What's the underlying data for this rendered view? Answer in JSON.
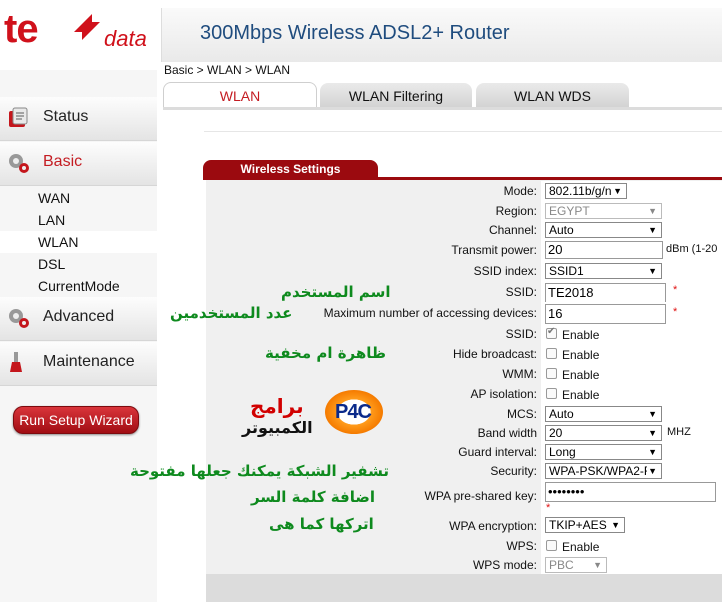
{
  "logo": {
    "brand": "te",
    "suffix": "data"
  },
  "header": {
    "title": "300Mbps Wireless ADSL2+ Router"
  },
  "breadcrumb": "Basic > WLAN > WLAN",
  "tabs": [
    {
      "label": "WLAN",
      "active": true
    },
    {
      "label": "WLAN Filtering",
      "active": false
    },
    {
      "label": "WLAN WDS",
      "active": false
    }
  ],
  "sidebar": {
    "groups": [
      {
        "label": "Status",
        "icon": "status-icon"
      },
      {
        "label": "Basic",
        "icon": "gears-icon",
        "active": true
      },
      {
        "label": "Advanced",
        "icon": "gears-icon"
      },
      {
        "label": "Maintenance",
        "icon": "wrench-icon"
      }
    ],
    "basic_items": [
      "WAN",
      "LAN",
      "WLAN",
      "DSL",
      "CurrentMode"
    ],
    "selected_item": "WLAN",
    "wizard_button": "Run Setup Wizard"
  },
  "section": {
    "title": "Wireless Settings"
  },
  "form": {
    "mode": {
      "label": "Mode:",
      "value": "802.11b/g/n"
    },
    "region": {
      "label": "Region:",
      "value": "EGYPT"
    },
    "channel": {
      "label": "Channel:",
      "value": "Auto"
    },
    "transmit_power": {
      "label": "Transmit power:",
      "value": "20",
      "unit": "dBm (1-20"
    },
    "ssid_index": {
      "label": "SSID index:",
      "value": "SSID1"
    },
    "ssid": {
      "label": "SSID:",
      "value": "TE2018",
      "required": "*"
    },
    "max_devices": {
      "label": "Maximum number of accessing devices:",
      "value": "16",
      "required": "*"
    },
    "ssid_enable": {
      "label": "SSID:",
      "option": "Enable",
      "checked": true
    },
    "hide_broadcast": {
      "label": "Hide broadcast:",
      "option": "Enable",
      "checked": false
    },
    "wmm": {
      "label": "WMM:",
      "option": "Enable",
      "checked": false
    },
    "ap_isolation": {
      "label": "AP isolation:",
      "option": "Enable",
      "checked": false
    },
    "mcs": {
      "label": "MCS:",
      "value": "Auto"
    },
    "bandwidth": {
      "label": "Band width",
      "value": "20",
      "unit": "MHZ"
    },
    "guard_interval": {
      "label": "Guard interval:",
      "value": "Long"
    },
    "security": {
      "label": "Security:",
      "value": "WPA-PSK/WPA2-F"
    },
    "wpa_key": {
      "label": "WPA pre-shared key:",
      "value": "••••••••",
      "required": "*"
    },
    "wpa_encryption": {
      "label": "WPA encryption:",
      "value": "TKIP+AES"
    },
    "wps": {
      "label": "WPS:",
      "option": "Enable",
      "checked": false
    },
    "wps_mode": {
      "label": "WPS mode:",
      "value": "PBC"
    }
  },
  "annotations": {
    "username": "اسم المستخدم",
    "user_count": "عدد المستخدمين",
    "visibility": "ظاهرة ام مخفية",
    "encryption": "تشفير الشبكة يمكنك جعلها مفتوحة",
    "add_password": "اضافة كلمة السر",
    "keep_as_is": "اتركها كما هى",
    "watermark_title": "برامج",
    "watermark_subtitle": "الكمبيوتر",
    "watermark_logo": "P4C"
  },
  "colors": {
    "brand_red": "#d0111b",
    "dark_red": "#9b0a0f",
    "title_blue": "#1f4c7e",
    "annotation_green": "#0e8a1e"
  }
}
